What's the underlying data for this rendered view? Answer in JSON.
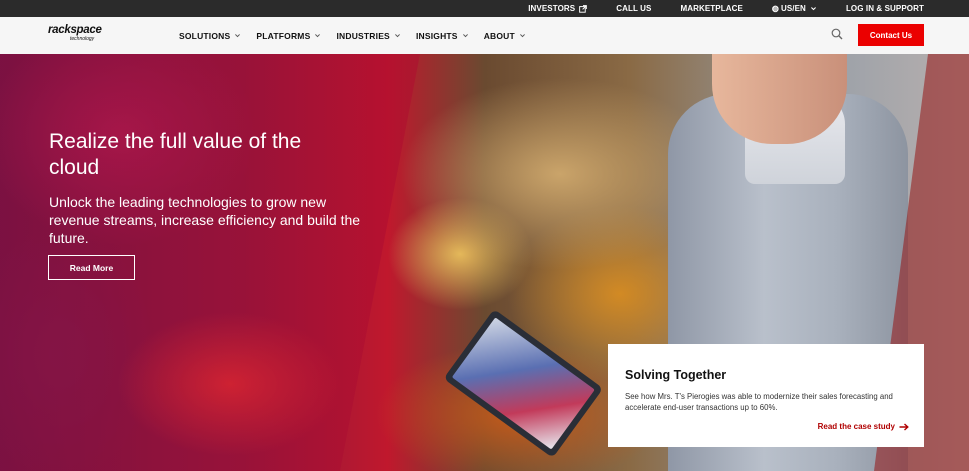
{
  "utility_nav": {
    "investors": "INVESTORS",
    "call_us": "CALL US",
    "marketplace": "MARKETPLACE",
    "locale": "US/EN",
    "login": "LOG IN & SUPPORT"
  },
  "brand": {
    "name": "rackspace",
    "tagline": "technology"
  },
  "main_nav": {
    "items": [
      "SOLUTIONS",
      "PLATFORMS",
      "INDUSTRIES",
      "INSIGHTS",
      "ABOUT"
    ],
    "contact_label": "Contact Us"
  },
  "hero": {
    "title": "Realize the full value of the cloud",
    "subtitle": "Unlock the leading technologies to grow new revenue streams, increase efficiency and build the future.",
    "cta_label": "Read More"
  },
  "case_card": {
    "title": "Solving Together",
    "text": "See how Mrs. T's Pierogies was able to modernize their sales forecasting and accelerate end-user transactions up to 60%.",
    "link_label": "Read the case study"
  },
  "colors": {
    "accent": "#eb0000",
    "link": "#b00000",
    "utility_bar": "#2b2b2b"
  }
}
